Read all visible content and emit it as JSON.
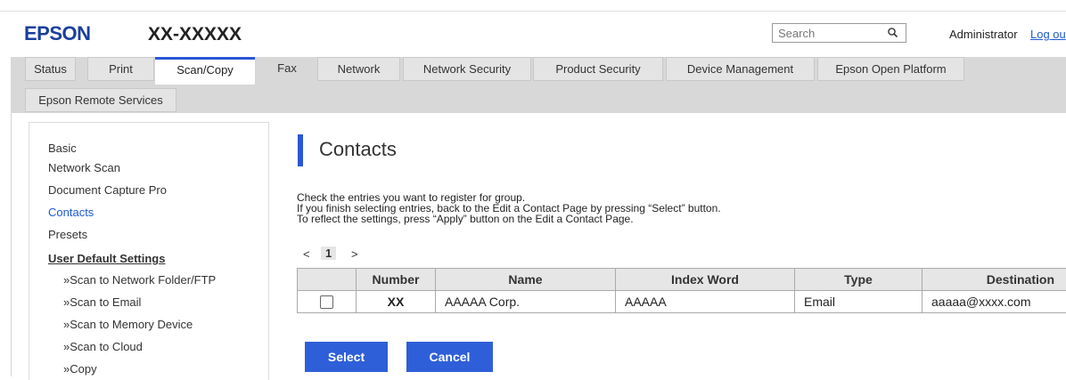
{
  "header": {
    "brand": "EPSON",
    "model": "XX-XXXXX",
    "search_placeholder": "Search",
    "user": "Administrator",
    "logout_label": "Log ou"
  },
  "tabs": {
    "row1": [
      "Status",
      "Print",
      "Scan/Copy",
      "Fax",
      "Network",
      "Network Security",
      "Product Security",
      "Device Management",
      "Epson Open Platform"
    ],
    "row2": [
      "Epson Remote Services"
    ],
    "active": "Scan/Copy"
  },
  "sidebar": {
    "items": [
      {
        "label": "Basic"
      },
      {
        "label": "Network Scan"
      },
      {
        "label": "Document Capture Pro"
      },
      {
        "label": "Contacts"
      },
      {
        "label": "Presets"
      },
      {
        "label": "User Default Settings"
      },
      {
        "label": "»Scan to Network Folder/FTP"
      },
      {
        "label": "»Scan to Email"
      },
      {
        "label": "»Scan to Memory Device"
      },
      {
        "label": "»Scan to Cloud"
      },
      {
        "label": "»Copy"
      }
    ],
    "selected": "Contacts"
  },
  "main": {
    "title": "Contacts",
    "instructions": [
      "Check the entries you want to register for group.",
      "If you finish selecting entries, back to the Edit a Contact Page by pressing “Select” button.",
      "To reflect the settings, press “Apply” button on the Edit a Contact Page."
    ],
    "pager": {
      "prev": "<",
      "current": "1",
      "next": ">"
    },
    "table": {
      "headers": [
        "",
        "Number",
        "Name",
        "Index Word",
        "Type",
        "Destination"
      ],
      "rows": [
        {
          "checked": false,
          "number": "XX",
          "name": "AAAAA Corp.",
          "index_word": "AAAAA",
          "type": "Email",
          "destination": "aaaaa@xxxx.com"
        }
      ]
    },
    "buttons": {
      "select": "Select",
      "cancel": "Cancel"
    }
  },
  "colors": {
    "brand": "#1a3f9c",
    "accent": "#2a57d6",
    "button": "#2f5fd8",
    "link": "#1f5bd0"
  }
}
